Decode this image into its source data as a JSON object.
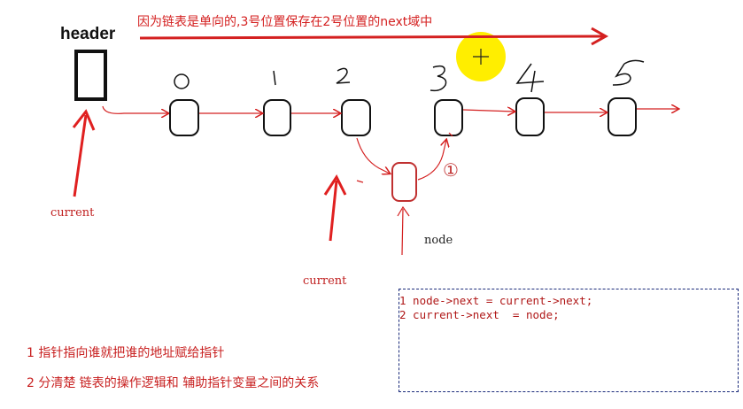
{
  "title_note": "因为链表是单向的,3号位置保存在2号位置的next域中",
  "header_label": "header",
  "index_labels": [
    "0",
    "1",
    "2",
    "3",
    "4",
    "5"
  ],
  "new_node_label": "①",
  "current_label_1": "current",
  "current_label_2": "current",
  "node_label": "node",
  "code_lines": [
    "1 node->next = current->next;",
    "2 current->next  = node;"
  ],
  "notes": [
    "1  指针指向谁就把谁的地址赋给指针",
    "2 分清楚 链表的操作逻辑和 辅助指针变量之间的关系"
  ],
  "colors": {
    "annotation_red": "#d42020",
    "node_black": "#111111",
    "new_node_red": "#c03030",
    "cursor_yellow": "#ffee00",
    "code_border": "#1a2a7a"
  }
}
